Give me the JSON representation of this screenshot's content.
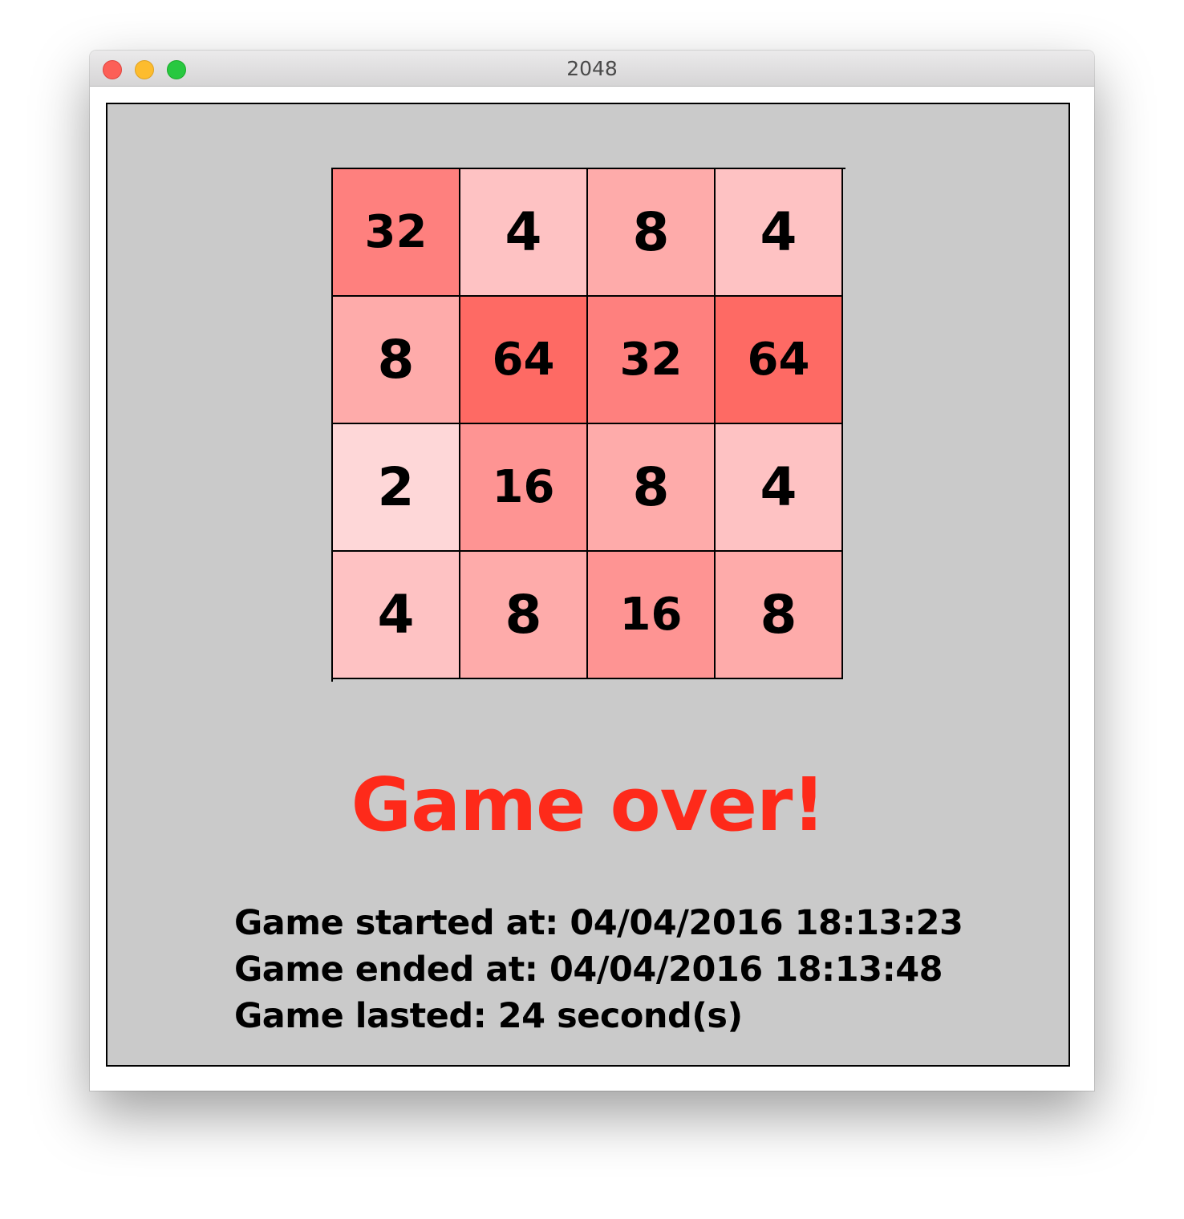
{
  "window": {
    "title": "2048"
  },
  "board": {
    "rows": [
      [
        32,
        4,
        8,
        4
      ],
      [
        8,
        64,
        32,
        64
      ],
      [
        2,
        16,
        8,
        4
      ],
      [
        4,
        8,
        16,
        8
      ]
    ],
    "tile_colors": {
      "2": "#fed7d8",
      "4": "#fec2c3",
      "8": "#feabaa",
      "16": "#fe9493",
      "32": "#fe807e",
      "64": "#fe6a64"
    }
  },
  "status": {
    "message": "Game over!",
    "message_color": "#fe2a1a"
  },
  "stats": {
    "started": "Game started at: 04/04/2016 18:13:23",
    "ended": "Game ended at: 04/04/2016 18:13:48",
    "lasted": "Game lasted: 24 second(s)"
  }
}
